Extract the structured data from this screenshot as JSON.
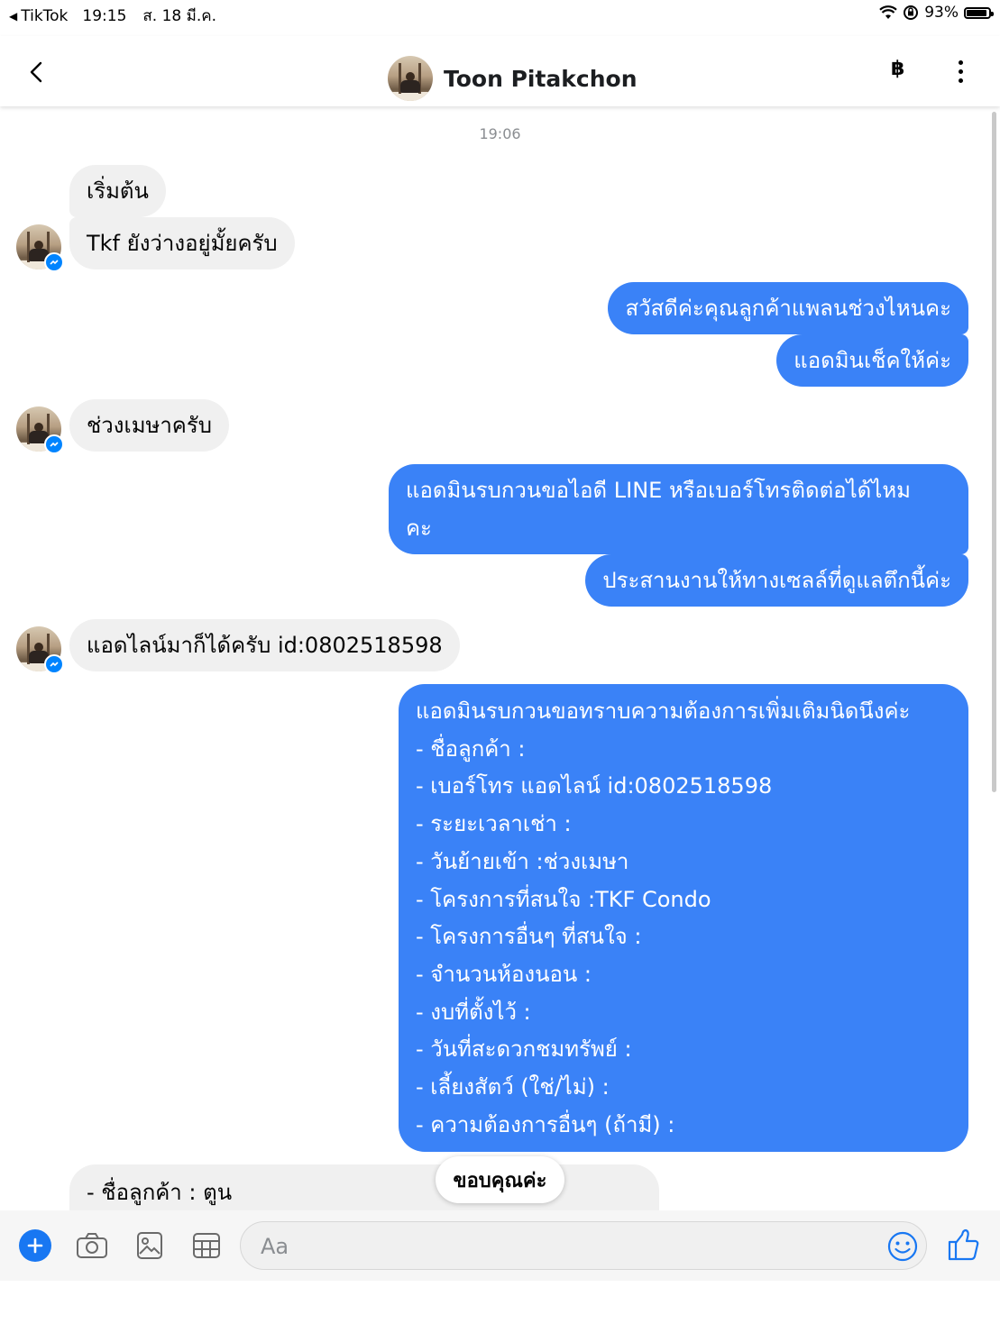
{
  "status": {
    "back_app": "TikTok",
    "time": "19:15",
    "date": "ส. 18 มี.ค.",
    "battery": "93%",
    "battery_level": 0.93
  },
  "header": {
    "contact_name": "Toon Pitakchon",
    "baht_symbol": "฿"
  },
  "timestamp": "19:06",
  "messages": [
    {
      "from": "them",
      "text": "เริ่มต้น"
    },
    {
      "from": "them",
      "text": "Tkf ยังว่างอยู่มั้ยครับ"
    },
    {
      "from": "me",
      "text": "สวัสดีค่ะคุณลูกค้าแพลนช่วงไหนคะ"
    },
    {
      "from": "me",
      "text": "แอดมินเช็คให้ค่ะ"
    },
    {
      "from": "them",
      "text": "ช่วงเมษาครับ"
    },
    {
      "from": "me",
      "lines": [
        "แอดมินรบกวนขอไอดี LINE หรือเบอร์โทรติดต่อได้ไหม",
        "คะ"
      ]
    },
    {
      "from": "me",
      "text": "ประสานงานให้ทางเซลล์ที่ดูแลตึกนี้ค่ะ"
    },
    {
      "from": "them",
      "text": "แอดไลน์มาก็ได้ครับ id:0802518598"
    },
    {
      "from": "me",
      "lines": [
        "แอดมินรบกวนขอทราบความต้องการเพิ่มเติมนิดนึงค่ะ",
        "- ชื่อลูกค้า :",
        "- เบอร์โทร แอดไลน์ id:0802518598",
        "- ระยะเวลาเช่า :",
        "- วันย้ายเข้า :ช่วงเมษา",
        "- โครงการที่สนใจ :TKF Condo",
        "- โครงการอื่นๆ ที่สนใจ :",
        "- จำนวนห้องนอน :",
        "- งบที่ตั้งไว้ :",
        "- วันที่สะดวกชมทรัพย์ :",
        "- เลี้ยงสัตว์ (ใช่/ไม่) :",
        "- ความต้องการอื่นๆ (ถ้ามี) :"
      ]
    },
    {
      "from": "them",
      "text": "- ชื่อลูกค้า : ตูน"
    }
  ],
  "quick_reply": "ขอบคุณค่ะ",
  "composer": {
    "placeholder": "Aa"
  },
  "colors": {
    "outgoing": "#3a82f7",
    "incoming": "#f0f0f0",
    "accent": "#1877f2"
  },
  "icons": [
    "back-chevron-icon",
    "baht-icon",
    "more-vertical-icon",
    "plus-icon",
    "camera-icon",
    "image-icon",
    "gif-sticker-icon",
    "emoji-icon",
    "like-icon",
    "messenger-badge-icon",
    "wifi-icon",
    "orientation-lock-icon",
    "battery-icon"
  ]
}
